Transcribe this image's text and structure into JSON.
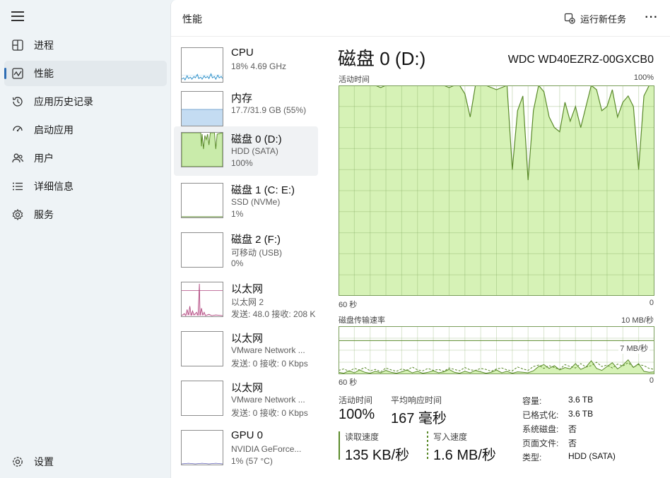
{
  "nav": {
    "items": [
      {
        "label": "进程",
        "icon": "processes-icon"
      },
      {
        "label": "性能",
        "icon": "performance-icon"
      },
      {
        "label": "应用历史记录",
        "icon": "app-history-icon"
      },
      {
        "label": "启动应用",
        "icon": "startup-apps-icon"
      },
      {
        "label": "用户",
        "icon": "users-icon"
      },
      {
        "label": "详细信息",
        "icon": "details-icon"
      },
      {
        "label": "服务",
        "icon": "services-icon"
      }
    ],
    "settings_label": "设置"
  },
  "header": {
    "title": "性能",
    "run_task_label": "运行新任务",
    "more_label": "···"
  },
  "devices": [
    {
      "name": "CPU",
      "sub1": "18% 4.69 GHz",
      "sub2": ""
    },
    {
      "name": "内存",
      "sub1": "17.7/31.9 GB (55%)",
      "sub2": ""
    },
    {
      "name": "磁盘 0 (D:)",
      "sub1": "HDD (SATA)",
      "sub2": "100%"
    },
    {
      "name": "磁盘 1 (C: E:)",
      "sub1": "SSD (NVMe)",
      "sub2": "1%"
    },
    {
      "name": "磁盘 2 (F:)",
      "sub1": "可移动 (USB)",
      "sub2": "0%"
    },
    {
      "name": "以太网",
      "sub1": "以太网 2",
      "sub2": "发送: 48.0  接收: 208 K"
    },
    {
      "name": "以太网",
      "sub1": "VMware Network ...",
      "sub2": "发送: 0  接收: 0 Kbps"
    },
    {
      "name": "以太网",
      "sub1": "VMware Network ...",
      "sub2": "发送: 0  接收: 0 Kbps"
    },
    {
      "name": "GPU 0",
      "sub1": "NVIDIA GeForce...",
      "sub2": "1% (57 °C)"
    }
  ],
  "detail": {
    "title": "磁盘 0 (D:)",
    "model": "WDC WD40EZRZ-00GXCB0",
    "active_chart": {
      "label": "活动时间",
      "max_label": "100%",
      "left_label": "60 秒",
      "right_label": "0"
    },
    "transfer_chart": {
      "label": "磁盘传输速率",
      "max_label": "10 MB/秒",
      "line_label": "7 MB/秒",
      "left_label": "60 秒",
      "right_label": "0"
    },
    "stats": {
      "active_time_label": "活动时间",
      "active_time_value": "100%",
      "response_label": "平均响应时间",
      "response_value": "167 毫秒",
      "read_label": "读取速度",
      "read_value": "135 KB/秒",
      "write_label": "写入速度",
      "write_value": "1.6 MB/秒"
    },
    "properties": [
      {
        "key": "容量:",
        "value": "3.6 TB"
      },
      {
        "key": "已格式化:",
        "value": "3.6 TB"
      },
      {
        "key": "系统磁盘:",
        "value": "否"
      },
      {
        "key": "页面文件:",
        "value": "否"
      },
      {
        "key": "类型:",
        "value": "HDD (SATA)"
      }
    ]
  },
  "chart_data": [
    {
      "type": "area",
      "title": "活动时间",
      "ylim": [
        0,
        100
      ],
      "xlim": [
        60,
        0
      ],
      "unit": "%",
      "x": [
        60,
        59,
        58,
        57,
        56,
        55,
        54,
        53,
        52,
        51,
        50,
        49,
        48,
        47,
        46,
        45,
        44,
        43,
        42,
        41,
        40,
        39,
        38,
        37,
        36,
        35,
        34,
        33,
        32,
        31,
        30,
        29,
        28,
        27,
        26,
        25,
        24,
        23,
        22,
        21,
        20,
        19,
        18,
        17,
        16,
        15,
        14,
        13,
        12,
        11,
        10,
        9,
        8,
        7,
        6,
        5,
        4,
        3,
        2,
        1,
        0
      ],
      "values": [
        100,
        100,
        100,
        100,
        100,
        100,
        100,
        100,
        99,
        100,
        100,
        100,
        100,
        100,
        100,
        100,
        100,
        100,
        100,
        100,
        100,
        99,
        100,
        100,
        96,
        85,
        100,
        100,
        100,
        99,
        98,
        99,
        100,
        60,
        88,
        95,
        55,
        88,
        100,
        97,
        85,
        80,
        78,
        92,
        83,
        90,
        80,
        90,
        100,
        98,
        88,
        90,
        98,
        85,
        92,
        95,
        90,
        60,
        95,
        100,
        100
      ],
      "grid": true,
      "color": "#5a8a2a",
      "fill": "#d6f2b6"
    },
    {
      "type": "line",
      "title": "磁盘传输速率",
      "ylim": [
        0,
        10
      ],
      "xlim": [
        60,
        0
      ],
      "unit": "MB/秒",
      "reference_line": 7,
      "series": [
        {
          "values": [
            0.4,
            0.2,
            0.7,
            0.3,
            0.9,
            0.4,
            0.2,
            0.6,
            0.3,
            0.8,
            0.4,
            0.2,
            0.5,
            0.9,
            0.3,
            0.6,
            0.2,
            0.4,
            0.7,
            0.3,
            0.5,
            1.0,
            0.4,
            0.2,
            0.6,
            0.3,
            0.8,
            0.5,
            0.2,
            0.4,
            0.9,
            0.3,
            0.6,
            0.2,
            0.5,
            0.4,
            0.3,
            0.7,
            1.6,
            2.0,
            1.2,
            1.8,
            0.9,
            1.4,
            1.1,
            2.2,
            1.0,
            1.5,
            2.8,
            1.2,
            0.8,
            1.6,
            2.4,
            1.1,
            1.9,
            3.0,
            1.4,
            2.2,
            0.6,
            0.4,
            0.5
          ]
        },
        {
          "values": [
            0.8,
            1.1,
            0.6,
            1.2,
            0.9,
            1.4,
            0.7,
            1.0,
            0.5,
            1.3,
            0.9,
            0.6,
            1.1,
            0.8,
            1.5,
            0.9,
            0.7,
            1.2,
            0.8,
            1.0,
            0.6,
            1.3,
            1.0,
            0.7,
            1.4,
            0.9,
            0.8,
            1.2,
            1.0,
            0.6,
            1.1,
            1.3,
            0.9,
            0.7,
            1.5,
            1.1,
            0.8,
            1.6,
            1.9,
            1.2,
            1.8,
            1.4,
            1.0,
            2.0,
            1.6,
            1.3,
            2.2,
            1.5,
            1.8,
            2.5,
            1.6,
            1.9,
            1.3,
            2.1,
            1.7,
            2.4,
            1.5,
            2.0,
            1.8,
            1.2,
            1.0
          ]
        }
      ],
      "grid": true
    }
  ]
}
